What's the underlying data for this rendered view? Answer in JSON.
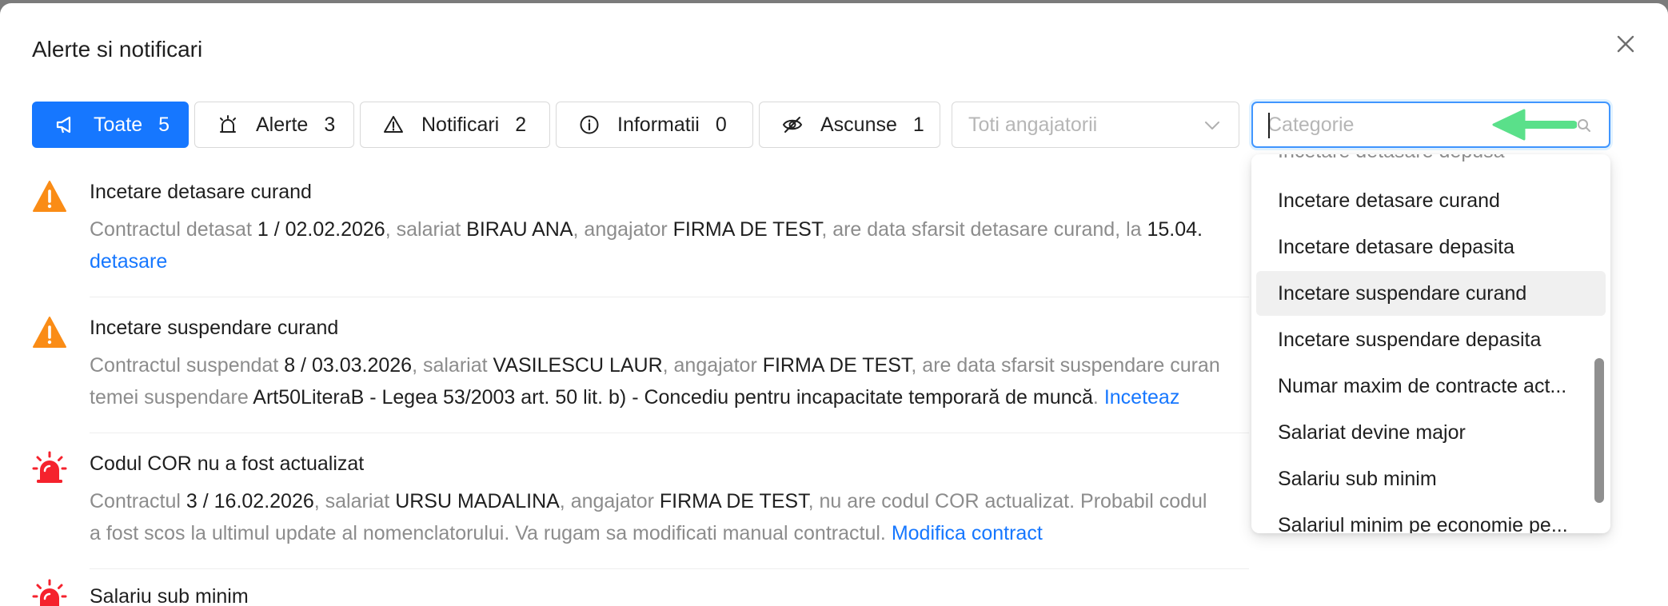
{
  "modal": {
    "title": "Alerte si notificari"
  },
  "tabs": [
    {
      "label": "Toate",
      "count": "5",
      "icon": "megaphone-icon"
    },
    {
      "label": "Alerte",
      "count": "3",
      "icon": "siren-icon"
    },
    {
      "label": "Notificari",
      "count": "2",
      "icon": "warning-icon"
    },
    {
      "label": "Informatii",
      "count": "0",
      "icon": "info-icon"
    },
    {
      "label": "Ascunse",
      "count": "1",
      "icon": "eye-off-icon"
    }
  ],
  "filters": {
    "employer_placeholder": "Toti angajatorii",
    "category_placeholder": "Categorie"
  },
  "colors": {
    "primary": "#1677ff",
    "warning": "#fa8c16",
    "danger": "#f5222d",
    "annotation_arrow": "#5ae08a"
  },
  "alerts": [
    {
      "icon": "warning-triangle-icon",
      "title": "Incetare detasare curand",
      "line1": {
        "t1": "Contractul detasat ",
        "d1": "1 / 02.02.2026",
        "t2": ", salariat ",
        "d2": "BIRAU ANA",
        "t3": ", angajator ",
        "d3": "FIRMA DE TEST",
        "t4": ", are data sfarsit detasare curand, la ",
        "d4": "15.04."
      },
      "line2": {
        "link": "detasare"
      }
    },
    {
      "icon": "warning-triangle-icon",
      "title": "Incetare suspendare curand",
      "line1": {
        "t1": "Contractul suspendat ",
        "d1": "8 / 03.03.2026",
        "t2": ", salariat ",
        "d2": "VASILESCU LAUR",
        "t3": ", angajator ",
        "d3": "FIRMA DE TEST",
        "t4": ", are data sfarsit suspendare curan"
      },
      "line2": {
        "t1": "temei suspendare ",
        "d1": "Art50LiteraB - Legea 53/2003 art. 50 lit. b) - Concediu pentru incapacitate temporară de muncă",
        "t2": ". ",
        "link": "Inceteaz"
      }
    },
    {
      "icon": "siren-icon",
      "title": "Codul COR nu a fost actualizat",
      "line1": {
        "t1": "Contractul ",
        "d1": "3 / 16.02.2026",
        "t2": ", salariat ",
        "d2": "URSU MADALINA",
        "t3": ", angajator ",
        "d3": "FIRMA DE TEST",
        "t4": ", nu are codul COR actualizat. Probabil codul"
      },
      "line2": {
        "t1": "a fost scos la ultimul update al nomenclatorului. Va rugam sa modificati manual contractul. ",
        "link": "Modifica contract"
      }
    },
    {
      "icon": "siren-icon",
      "title": "Salariu sub minim"
    }
  ],
  "category_dropdown": {
    "cut_top": "Incetare detasare depusa",
    "options": [
      "Incetare detasare curand",
      "Incetare detasare depasita",
      "Incetare suspendare curand",
      "Incetare suspendare depasita",
      "Numar maxim de contracte act...",
      "Salariat devine major",
      "Salariu sub minim",
      "Salariul minim pe economie pe..."
    ],
    "active_option": "Incetare suspendare curand"
  }
}
